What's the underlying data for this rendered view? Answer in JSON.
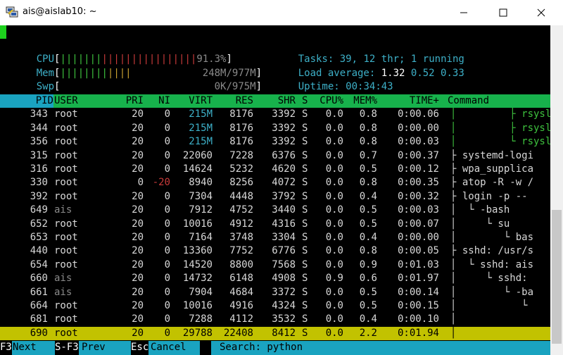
{
  "window": {
    "title": "ais@aislab10: ~"
  },
  "meters": {
    "cpu": {
      "label": "CPU",
      "value": "91.3%"
    },
    "mem": {
      "label": "Mem",
      "value": "248M/977M"
    },
    "swp": {
      "label": "Swp",
      "value": "0K/975M"
    },
    "tasks": {
      "label": "Tasks:",
      "count": "39,",
      "threads": "12",
      "thr_label": "thr;",
      "running": "1",
      "running_label": "running"
    },
    "load": {
      "label": "Load average:",
      "v1": "1.32",
      "v2": "0.52",
      "v3": "0.33"
    },
    "uptime": {
      "label": "Uptime:",
      "value": "00:34:43"
    }
  },
  "columns": [
    "PID",
    "USER",
    "PRI",
    "NI",
    "VIRT",
    "RES",
    "SHR",
    "S",
    "CPU%",
    "MEM%",
    "TIME+",
    "Command"
  ],
  "rows": [
    {
      "pid": "343",
      "user": "root",
      "pri": "20",
      "ni": "0",
      "virt": "215M",
      "res": "8176",
      "shr": "3392",
      "s": "S",
      "cpu": "0.0",
      "mem": "0.8",
      "time": "0:00.06",
      "cmd": "│         ├ rsyslogd"
    },
    {
      "pid": "344",
      "user": "root",
      "pri": "20",
      "ni": "0",
      "virt": "215M",
      "res": "8176",
      "shr": "3392",
      "s": "S",
      "cpu": "0.0",
      "mem": "0.8",
      "time": "0:00.00",
      "cmd": "│         ├ rsyslogd"
    },
    {
      "pid": "356",
      "user": "root",
      "pri": "20",
      "ni": "0",
      "virt": "215M",
      "res": "8176",
      "shr": "3392",
      "s": "S",
      "cpu": "0.0",
      "mem": "0.8",
      "time": "0:00.03",
      "cmd": "│         └ rsyslogd"
    },
    {
      "pid": "315",
      "user": "root",
      "pri": "20",
      "ni": "0",
      "virt": "22060",
      "res": "7228",
      "shr": "6376",
      "s": "S",
      "cpu": "0.0",
      "mem": "0.7",
      "time": "0:00.37",
      "cmd": "├ systemd-logi"
    },
    {
      "pid": "316",
      "user": "root",
      "pri": "20",
      "ni": "0",
      "virt": "14624",
      "res": "5232",
      "shr": "4620",
      "s": "S",
      "cpu": "0.0",
      "mem": "0.5",
      "time": "0:00.12",
      "cmd": "├ wpa_supplica"
    },
    {
      "pid": "330",
      "user": "root",
      "pri": "0",
      "ni": "-20",
      "virt": "8940",
      "res": "8256",
      "shr": "4072",
      "s": "S",
      "cpu": "0.0",
      "mem": "0.8",
      "time": "0:00.35",
      "cmd": "├ atop -R -w /"
    },
    {
      "pid": "392",
      "user": "root",
      "pri": "20",
      "ni": "0",
      "virt": "7304",
      "res": "4448",
      "shr": "3792",
      "s": "S",
      "cpu": "0.0",
      "mem": "0.4",
      "time": "0:00.32",
      "cmd": "├ login -p --"
    },
    {
      "pid": "649",
      "user": "ais",
      "pri": "20",
      "ni": "0",
      "virt": "7912",
      "res": "4752",
      "shr": "3440",
      "s": "S",
      "cpu": "0.0",
      "mem": "0.5",
      "time": "0:00.03",
      "cmd": "│  └ -bash"
    },
    {
      "pid": "652",
      "user": "root",
      "pri": "20",
      "ni": "0",
      "virt": "10016",
      "res": "4912",
      "shr": "4316",
      "s": "S",
      "cpu": "0.0",
      "mem": "0.5",
      "time": "0:00.07",
      "cmd": "│     └ su"
    },
    {
      "pid": "653",
      "user": "root",
      "pri": "20",
      "ni": "0",
      "virt": "7164",
      "res": "3748",
      "shr": "3304",
      "s": "S",
      "cpu": "0.0",
      "mem": "0.4",
      "time": "0:00.00",
      "cmd": "│        └ bas"
    },
    {
      "pid": "440",
      "user": "root",
      "pri": "20",
      "ni": "0",
      "virt": "13360",
      "res": "7752",
      "shr": "6776",
      "s": "S",
      "cpu": "0.0",
      "mem": "0.8",
      "time": "0:00.05",
      "cmd": "├ sshd: /usr/s"
    },
    {
      "pid": "654",
      "user": "root",
      "pri": "20",
      "ni": "0",
      "virt": "14520",
      "res": "8800",
      "shr": "7568",
      "s": "S",
      "cpu": "0.0",
      "mem": "0.9",
      "time": "0:01.03",
      "cmd": "│  └ sshd: ais"
    },
    {
      "pid": "660",
      "user": "ais",
      "pri": "20",
      "ni": "0",
      "virt": "14732",
      "res": "6148",
      "shr": "4908",
      "s": "S",
      "cpu": "0.9",
      "mem": "0.6",
      "time": "0:01.97",
      "cmd": "│     └ sshd:"
    },
    {
      "pid": "661",
      "user": "ais",
      "pri": "20",
      "ni": "0",
      "virt": "7904",
      "res": "4684",
      "shr": "3372",
      "s": "S",
      "cpu": "0.0",
      "mem": "0.5",
      "time": "0:00.14",
      "cmd": "│        └ -ba"
    },
    {
      "pid": "664",
      "user": "root",
      "pri": "20",
      "ni": "0",
      "virt": "10016",
      "res": "4916",
      "shr": "4324",
      "s": "S",
      "cpu": "0.0",
      "mem": "0.5",
      "time": "0:00.15",
      "cmd": "│           └"
    },
    {
      "pid": "681",
      "user": "root",
      "pri": "20",
      "ni": "0",
      "virt": "7288",
      "res": "4112",
      "shr": "3532",
      "s": "S",
      "cpu": "0.0",
      "mem": "0.4",
      "time": "0:00.10",
      "cmd": "│"
    },
    {
      "pid": "690",
      "user": "root",
      "pri": "20",
      "ni": "0",
      "virt": "29788",
      "res": "22408",
      "shr": "8412",
      "s": "S",
      "cpu": "0.0",
      "mem": "2.2",
      "time": "0:01.94",
      "cmd": "│",
      "selected": true
    }
  ],
  "footer": {
    "f3_key": "F3",
    "f3_label": "Next",
    "sf3_key": "S-F3",
    "sf3_label": "Prev",
    "esc_key": "Esc",
    "esc_label": "Cancel",
    "search_label": "Search: python"
  },
  "colors": {
    "header_green": "#17b24c",
    "cyan": "#1aa3c0",
    "selected_row": "#c2c200"
  }
}
